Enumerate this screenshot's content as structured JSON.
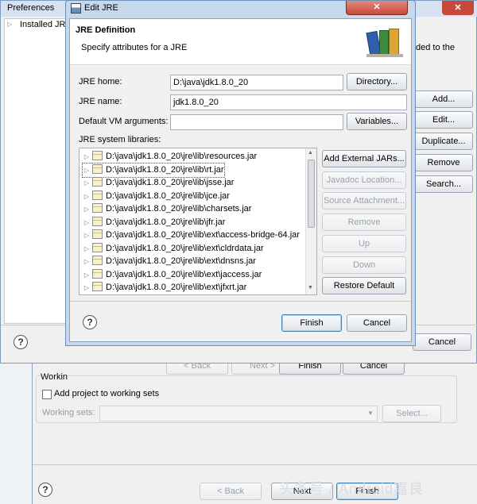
{
  "background_window": {
    "cancel_label": "Cancel",
    "title_fragment_ded": "ded to the",
    "buttons": [
      "Add...",
      "Edit...",
      "Duplicate...",
      "Remove",
      "Search..."
    ]
  },
  "preferences": {
    "title": "Preferences",
    "tree_item": "Installed JRE",
    "cancel_label": "Cancel"
  },
  "wizard_bg": {
    "back": "< Back",
    "next": "Next >",
    "finish": "Finish",
    "cancel": "Cancel",
    "working_label": "Workin",
    "add_project_label": "Add project to working sets",
    "working_sets_label": "Working sets:",
    "select_label": "Select...",
    "bottom_back": "< Back",
    "bottom_next": "Next",
    "bottom_finish": "Finish",
    "watermark": "头条号 / Android嘉良"
  },
  "dialog": {
    "title": "Edit JRE",
    "header_title": "JRE Definition",
    "header_subtitle": "Specify attributes for a JRE",
    "jre_home_label": "JRE home:",
    "jre_home_value": "D:\\java\\jdk1.8.0_20",
    "directory_button": "Directory...",
    "jre_name_label": "JRE name:",
    "jre_name_value": "jdk1.8.0_20",
    "vm_args_label": "Default VM arguments:",
    "vm_args_value": "",
    "variables_button": "Variables...",
    "libraries_label": "JRE system libraries:",
    "libraries": [
      "D:\\java\\jdk1.8.0_20\\jre\\lib\\resources.jar",
      "D:\\java\\jdk1.8.0_20\\jre\\lib\\rt.jar",
      "D:\\java\\jdk1.8.0_20\\jre\\lib\\jsse.jar",
      "D:\\java\\jdk1.8.0_20\\jre\\lib\\jce.jar",
      "D:\\java\\jdk1.8.0_20\\jre\\lib\\charsets.jar",
      "D:\\java\\jdk1.8.0_20\\jre\\lib\\jfr.jar",
      "D:\\java\\jdk1.8.0_20\\jre\\lib\\ext\\access-bridge-64.jar",
      "D:\\java\\jdk1.8.0_20\\jre\\lib\\ext\\cldrdata.jar",
      "D:\\java\\jdk1.8.0_20\\jre\\lib\\ext\\dnsns.jar",
      "D:\\java\\jdk1.8.0_20\\jre\\lib\\ext\\jaccess.jar",
      "D:\\java\\jdk1.8.0_20\\jre\\lib\\ext\\jfxrt.jar"
    ],
    "add_external_jars": "Add External JARs...",
    "javadoc_location": "Javadoc Location...",
    "source_attachment": "Source Attachment...",
    "remove": "Remove",
    "up": "Up",
    "down": "Down",
    "restore_default": "Restore Default",
    "finish": "Finish",
    "cancel": "Cancel",
    "help_glyph": "?"
  },
  "colors": {
    "frame": "#c6d8ec",
    "frame_border": "#6b8fb5",
    "close_red": "#c7493a"
  }
}
